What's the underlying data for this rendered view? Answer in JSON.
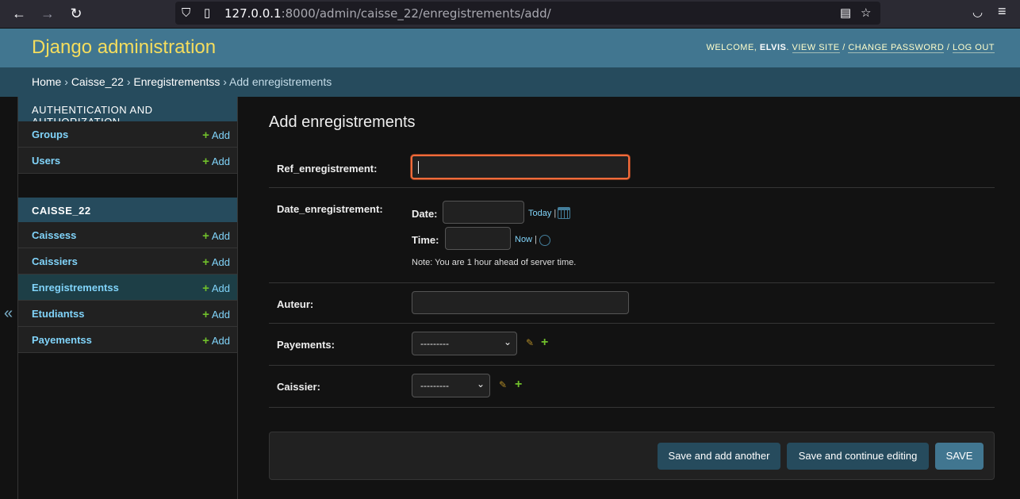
{
  "browser": {
    "url_host": "127.0.0.1",
    "url_rest": ":8000/admin/caisse_22/enregistrements/add/"
  },
  "header": {
    "branding": "Django administration",
    "welcome": "WELCOME,",
    "username": "ELVIS",
    "view_site": "VIEW SITE",
    "change_password": "CHANGE PASSWORD",
    "log_out": "LOG OUT"
  },
  "breadcrumbs": {
    "home": "Home",
    "app": "Caisse_22",
    "model": "Enregistrementss",
    "current": "Add enregistrements",
    "sep": "›"
  },
  "sidebar": {
    "toggle": "«",
    "modules": [
      {
        "caption": "AUTHENTICATION AND AUTHORIZATION",
        "items": [
          {
            "label": "Groups",
            "add": "Add"
          },
          {
            "label": "Users",
            "add": "Add"
          }
        ]
      },
      {
        "caption": "CAISSE_22",
        "items": [
          {
            "label": "Caissess",
            "add": "Add"
          },
          {
            "label": "Caissiers",
            "add": "Add"
          },
          {
            "label": "Enregistrementss",
            "add": "Add",
            "active": true
          },
          {
            "label": "Etudiantss",
            "add": "Add"
          },
          {
            "label": "Payementss",
            "add": "Add"
          }
        ]
      }
    ]
  },
  "form": {
    "title": "Add enregistrements",
    "ref_label": "Ref_enregistrement:",
    "ref_value": "",
    "date_label": "Date_enregistrement:",
    "date_sub": "Date:",
    "date_value": "",
    "today": "Today",
    "time_sub": "Time:",
    "time_value": "",
    "now": "Now",
    "separator": "|",
    "note": "Note: You are 1 hour ahead of server time.",
    "auteur_label": "Auteur:",
    "auteur_value": "",
    "payements_label": "Payements:",
    "payements_selected": "---------",
    "caissier_label": "Caissier:",
    "caissier_selected": "---------"
  },
  "buttons": {
    "save_add_another": "Save and add another",
    "save_continue": "Save and continue editing",
    "save": "SAVE"
  },
  "colors": {
    "header_bg": "#417690",
    "branding": "#f5dd5d",
    "link": "#81d4fa",
    "add_plus": "#70bf2b",
    "focus_border": "#f26b3a"
  }
}
